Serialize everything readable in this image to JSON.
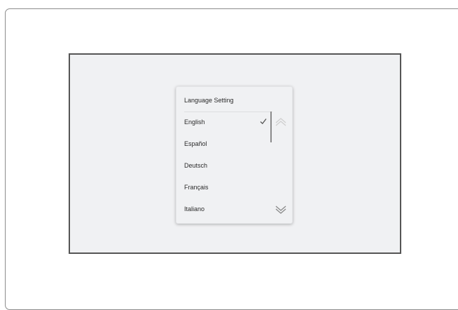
{
  "dialog": {
    "title": "Language Setting",
    "items": [
      {
        "label": "English",
        "selected": true
      },
      {
        "label": "Español",
        "selected": false
      },
      {
        "label": "Deutsch",
        "selected": false
      },
      {
        "label": "Français",
        "selected": false
      },
      {
        "label": "Italiano",
        "selected": false
      }
    ]
  },
  "icons": {
    "checkmark": "check-icon",
    "scroll_up": "double-chevron-up-icon",
    "scroll_down": "double-chevron-down-icon"
  },
  "colors": {
    "screen_background": "#f0f1f3",
    "screen_border": "#555555",
    "text": "#2b2b2b",
    "scroll_indicator": "#8a8a8a",
    "arrow_disabled": "#cfcfcf",
    "arrow_enabled": "#8a8a8a"
  }
}
